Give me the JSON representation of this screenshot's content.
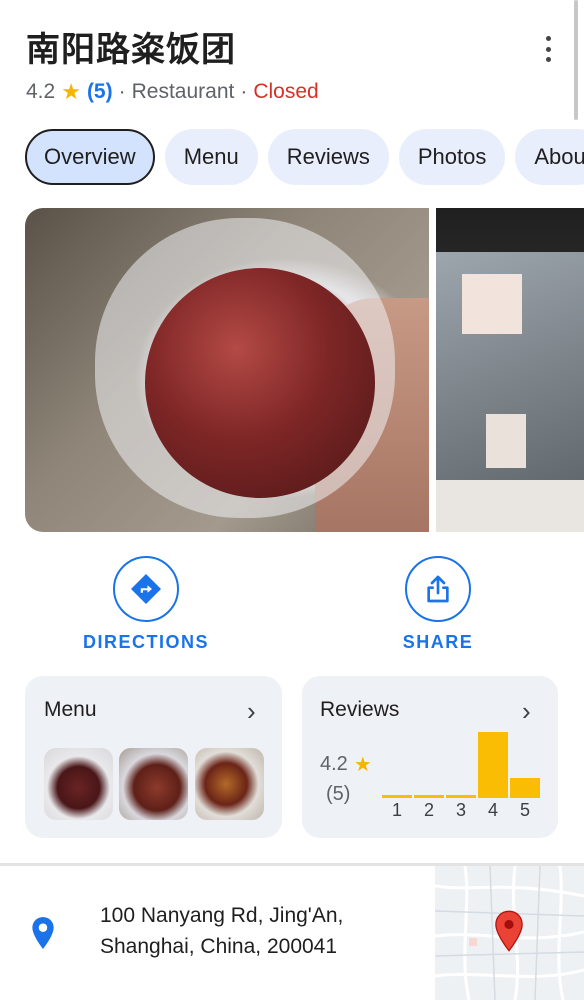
{
  "place": {
    "title": "南阳路粢饭团",
    "rating": "4.2",
    "review_count": "(5)",
    "category": "Restaurant",
    "status": "Closed",
    "separator": "·"
  },
  "tabs": [
    {
      "label": "Overview",
      "active": true
    },
    {
      "label": "Menu",
      "active": false
    },
    {
      "label": "Reviews",
      "active": false
    },
    {
      "label": "Photos",
      "active": false
    },
    {
      "label": "Abou",
      "active": false
    }
  ],
  "actions": {
    "directions_label": "DIRECTIONS",
    "share_label": "SHARE"
  },
  "menu_card": {
    "heading": "Menu",
    "chevron": "›"
  },
  "reviews_card": {
    "heading": "Reviews",
    "chevron": "›",
    "rating": "4.2",
    "count": "(5)",
    "distribution": [
      {
        "stars": "1",
        "share": 0.04
      },
      {
        "stars": "2",
        "share": 0.04
      },
      {
        "stars": "3",
        "share": 0.04
      },
      {
        "stars": "4",
        "share": 1.0
      },
      {
        "stars": "5",
        "share": 0.3
      }
    ]
  },
  "address": {
    "line1": "100 Nanyang Rd, Jing'An,",
    "line2": "Shanghai, China, 200041"
  },
  "colors": {
    "accent": "#1a73e8",
    "closed": "#d93025",
    "star": "#f4b400",
    "bar": "#fbbc04",
    "tab_bg": "#e8eefb",
    "tab_active_bg": "#d3e3fd",
    "card_bg": "#eef1f5"
  },
  "icons": {
    "more": "more-vert-icon",
    "star": "star-icon",
    "directions": "directions-icon",
    "share": "share-icon",
    "chevron": "chevron-right-icon",
    "pin": "location-pin-icon",
    "map_pin": "map-marker-icon"
  }
}
